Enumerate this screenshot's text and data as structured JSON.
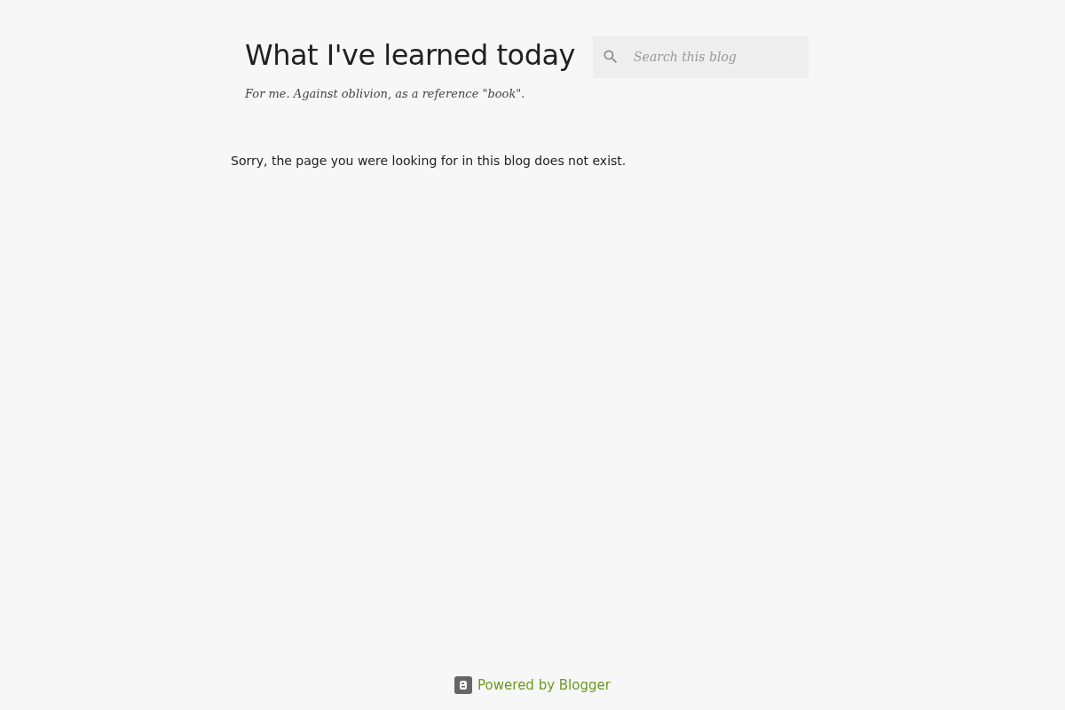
{
  "header": {
    "title": "What I've learned today",
    "description": "For me. Against oblivion, as a reference \"book\"."
  },
  "search": {
    "placeholder": "Search this blog"
  },
  "message": "Sorry, the page you were looking for in this blog does not exist.",
  "footer": {
    "link": "Powered by Blogger"
  }
}
